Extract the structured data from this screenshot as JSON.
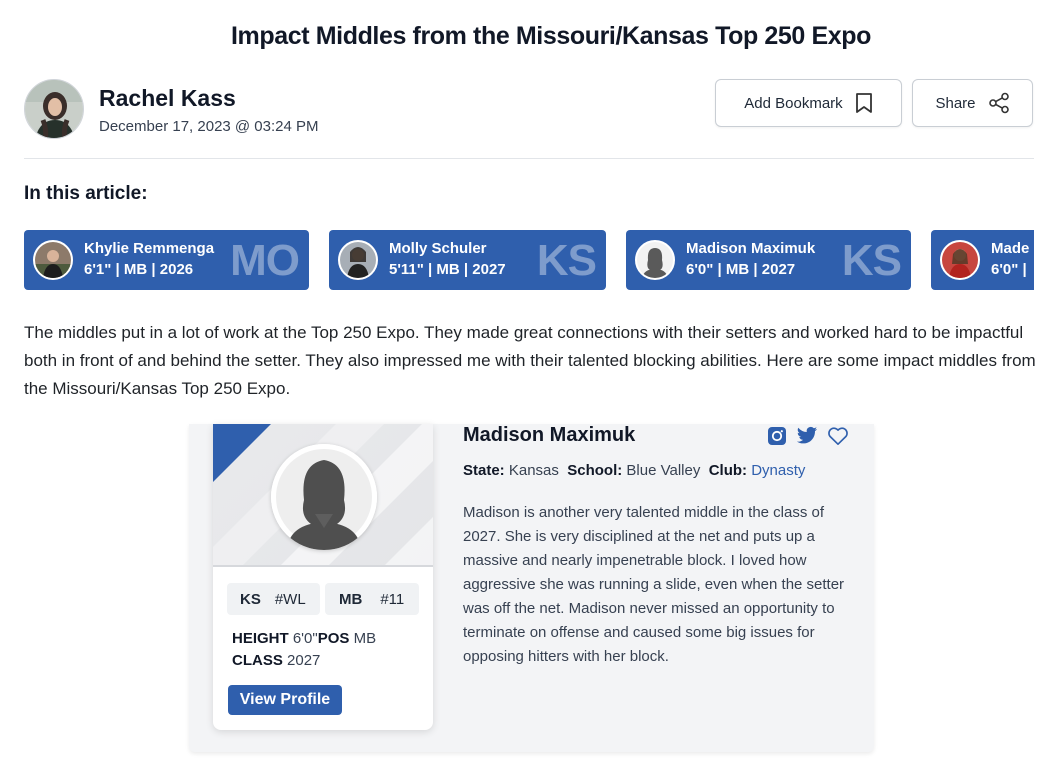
{
  "article": {
    "title": "Impact Middles from the Missouri/Kansas Top 250 Expo",
    "author": "Rachel Kass",
    "date": "December 17, 2023 @ 03:24 PM",
    "bookmark_label": "Add Bookmark",
    "share_label": "Share",
    "in_article_heading": "In this article:",
    "intro": "The middles put in a lot of work at the Top 250 Expo. They made great connections with their setters and worked hard to be impactful both in front of and behind the setter. They also impressed me with their talented blocking abilities. Here are some impact middles from the Missouri/Kansas Top 250 Expo."
  },
  "chips": [
    {
      "name": "Khylie Remmenga",
      "meta": "6'1\" | MB | 2026",
      "state": "MO"
    },
    {
      "name": "Molly Schuler",
      "meta": "5'11\" | MB | 2027",
      "state": "KS"
    },
    {
      "name": "Madison Maximuk",
      "meta": "6'0\" | MB | 2027",
      "state": "KS"
    },
    {
      "name": "Made",
      "meta": "6'0\" |",
      "state": ""
    }
  ],
  "player": {
    "name": "Madison Maximuk",
    "state_tag": "KS",
    "state_rank": "#WL",
    "pos_tag": "MB",
    "pos_rank": "#11",
    "height_label": "HEIGHT",
    "height_value": "6'0\"",
    "pos_label": "POS",
    "pos_value": "MB",
    "class_label": "CLASS",
    "class_value": "2027",
    "view_profile_label": "View Profile",
    "state_field_label": "State:",
    "state_field_value": "Kansas",
    "school_label": "School:",
    "school_value": "Blue Valley",
    "club_label": "Club:",
    "club_value": "Dynasty",
    "bio": "Madison is another very talented middle in the class of 2027. She is very disciplined at the net and puts up a massive and nearly impenetrable block. I loved how aggressive she was running a slide, even when the setter was off the net. Madison never missed an opportunity to terminate on offense and caused some big issues for opposing hitters with her block."
  },
  "icons": {
    "bookmark": "bookmark-icon",
    "share": "share-icon",
    "instagram": "instagram-icon",
    "twitter": "twitter-icon",
    "favorite": "heart-icon"
  },
  "colors": {
    "accent": "#2f5fad",
    "card_background": "#f3f4f6"
  }
}
